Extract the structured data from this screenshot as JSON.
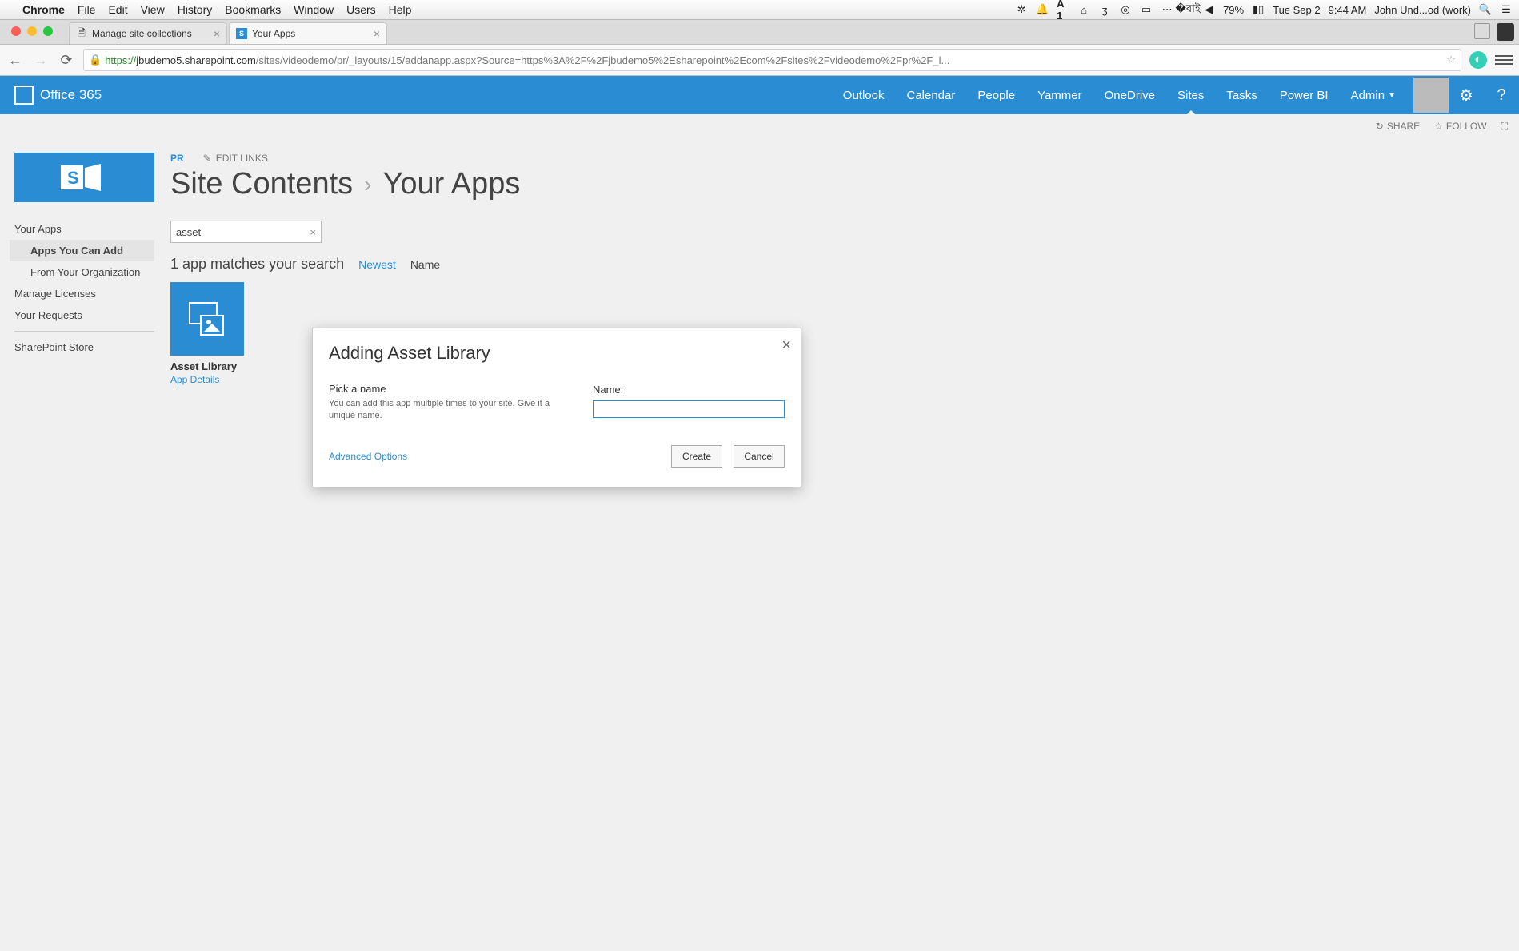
{
  "mac_menu": {
    "app": "Chrome",
    "items": [
      "File",
      "Edit",
      "View",
      "History",
      "Bookmarks",
      "Window",
      "Users",
      "Help"
    ],
    "right": {
      "battery": "79%",
      "date": "Tue Sep 2",
      "time": "9:44 AM",
      "user": "John Und...od (work)"
    }
  },
  "chrome": {
    "tabs": [
      {
        "title": "Manage site collections"
      },
      {
        "title": "Your Apps"
      }
    ],
    "url_https": "https://",
    "url_host": "jbudemo5.sharepoint.com",
    "url_path": "/sites/videodemo/pr/_layouts/15/addanapp.aspx?Source=https%3A%2F%2Fjbudemo5%2Esharepoint%2Ecom%2Fsites%2Fvideodemo%2Fpr%2F_l..."
  },
  "suite": {
    "brand": "Office 365",
    "nav": [
      "Outlook",
      "Calendar",
      "People",
      "Yammer",
      "OneDrive",
      "Sites",
      "Tasks",
      "Power BI",
      "Admin"
    ],
    "active": "Sites"
  },
  "actions": {
    "share": "SHARE",
    "follow": "FOLLOW"
  },
  "breadcrumb": {
    "site": "PR",
    "edit_links": "EDIT LINKS",
    "l1": "Site Contents",
    "l2": "Your Apps"
  },
  "quick_launch": {
    "your_apps": "Your Apps",
    "can_add": "Apps You Can Add",
    "from_org": "From Your Organization",
    "manage_lic": "Manage Licenses",
    "your_req": "Your Requests",
    "store": "SharePoint Store"
  },
  "search": {
    "value": "asset"
  },
  "results": {
    "count_text": "1 app matches your search",
    "filter_newest": "Newest",
    "filter_name": "Name"
  },
  "app_tile": {
    "name": "Asset Library",
    "details": "App Details"
  },
  "modal": {
    "title": "Adding Asset Library",
    "pick": "Pick a name",
    "hint": "You can add this app multiple times to your site. Give it a unique name.",
    "name_label": "Name:",
    "name_value": "",
    "advanced": "Advanced Options",
    "create": "Create",
    "cancel": "Cancel"
  }
}
